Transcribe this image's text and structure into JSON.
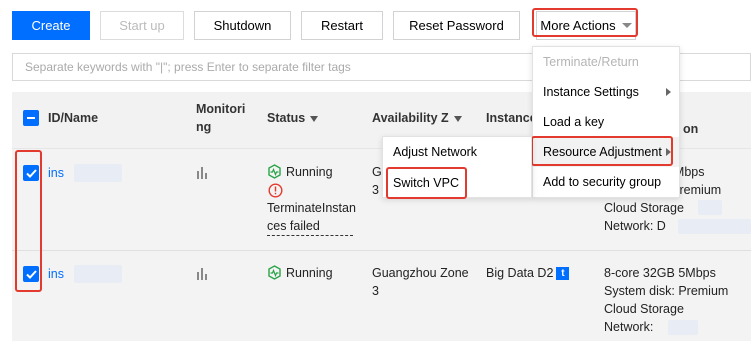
{
  "toolbar": {
    "create": "Create",
    "start_up": "Start up",
    "shutdown": "Shutdown",
    "restart": "Restart",
    "reset_password": "Reset Password",
    "more_actions": "More Actions"
  },
  "search": {
    "placeholder": "Separate keywords with \"|\"; press Enter to separate filter tags"
  },
  "table": {
    "headers": {
      "id_name": "ID/Name",
      "monitoring_1": "Monitori",
      "monitoring_2": "ng",
      "status": "Status",
      "availability": "Availability Z",
      "instance": "Instance",
      "config": "on"
    },
    "rows": [
      {
        "id": "ins",
        "status": "Running",
        "error_1": "TerminateInstan",
        "error_2": "ces failed",
        "zone_1": "G",
        "zone_2": "3",
        "config_1": "10Mbps",
        "config_2": "disk: Premium",
        "config_3": "Cloud Storage",
        "config_4": "Network: D"
      },
      {
        "id": "ins",
        "status": "Running",
        "zone_1": "Guangzhou Zone",
        "zone_2": "3",
        "instance_type": "Big Data D2",
        "config_1": "8-core 32GB 5Mbps",
        "config_2": "System disk: Premium",
        "config_3": "Cloud Storage",
        "config_4": "Network:"
      }
    ]
  },
  "more_menu": {
    "items": [
      "Terminate/Return",
      "Instance Settings",
      "Load a key",
      "Resource Adjustment",
      "Add to security group"
    ]
  },
  "sub_menu": {
    "items": [
      "Adjust Network",
      "Switch VPC"
    ]
  },
  "colors": {
    "accent": "#006eff",
    "highlight_box": "#e23a2f",
    "running": "#29a347",
    "error": "#e23a2f"
  }
}
